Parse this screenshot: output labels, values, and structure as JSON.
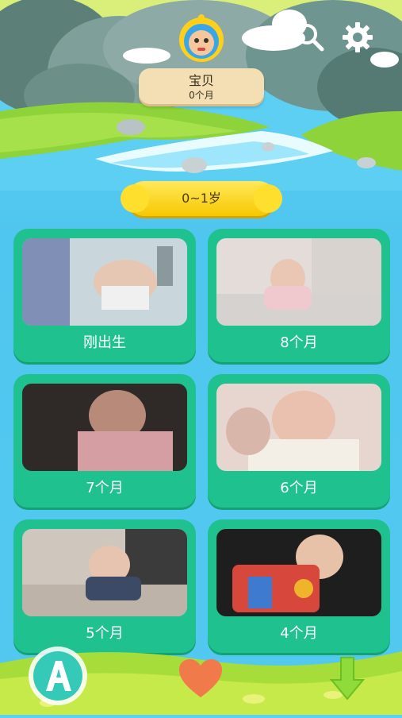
{
  "header": {
    "search_icon": "search-icon",
    "settings_icon": "gear-icon",
    "avatar_icon": "robot-avatar-icon"
  },
  "profile": {
    "name": "宝贝",
    "age": "0个月"
  },
  "age_range": {
    "label": "0~1岁"
  },
  "videos": [
    {
      "label": "刚出生"
    },
    {
      "label": "8个月"
    },
    {
      "label": "7个月"
    },
    {
      "label": "6个月"
    },
    {
      "label": "5个月"
    },
    {
      "label": "4个月"
    }
  ],
  "bottom_nav": {
    "left_icon": "letter-a-icon",
    "center_icon": "heart-icon",
    "right_icon": "down-arrow-icon"
  },
  "colors": {
    "card": "#1fc28f",
    "age_bar": "#ffd400",
    "sky": "#5ed0f2"
  }
}
